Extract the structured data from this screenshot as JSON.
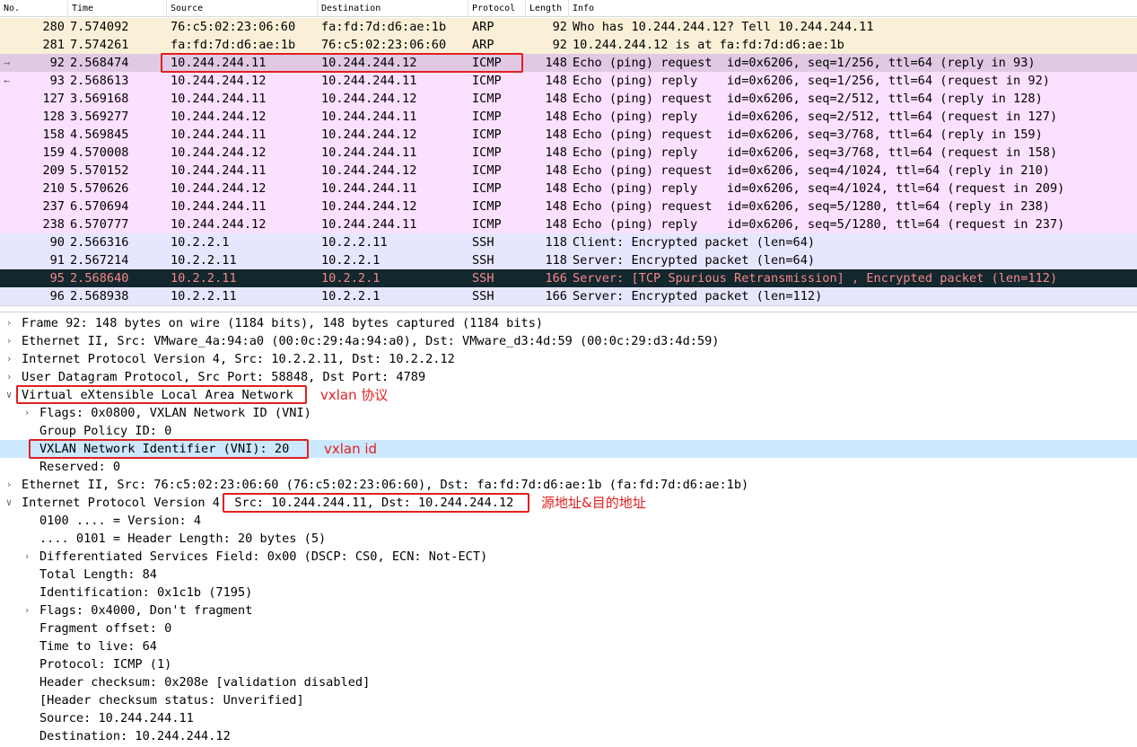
{
  "columns": {
    "no": "No.",
    "time": "Time",
    "source": "Source",
    "destination": "Destination",
    "protocol": "Protocol",
    "length": "Length",
    "info": "Info"
  },
  "colors": {
    "arp_bg": "#faf0d7",
    "icmp_bg": "#fce0ff",
    "selected_bg": "#e1c9e4",
    "ssh_bg": "#e7e6ff",
    "dark_bg": "#12272e",
    "dark_fg": "#f78787",
    "highlight_bg": "#cce8ff",
    "annotation": "#e02020"
  },
  "packets": [
    {
      "no": "280",
      "time": "7.574092",
      "src": "76:c5:02:23:06:60",
      "dst": "fa:fd:7d:d6:ae:1b",
      "proto": "ARP",
      "len": "92",
      "info": "Who has 10.244.244.12? Tell 10.244.244.11",
      "style": "arp"
    },
    {
      "no": "281",
      "time": "7.574261",
      "src": "fa:fd:7d:d6:ae:1b",
      "dst": "76:c5:02:23:06:60",
      "proto": "ARP",
      "len": "92",
      "info": "10.244.244.12 is at fa:fd:7d:d6:ae:1b",
      "style": "arp"
    },
    {
      "no": "92",
      "time": "2.568474",
      "src": "10.244.244.11",
      "dst": "10.244.244.12",
      "proto": "ICMP",
      "len": "148",
      "info": "Echo (ping) request  id=0x6206, seq=1/256, ttl=64 (reply in 93)",
      "style": "selected",
      "marker": "→"
    },
    {
      "no": "93",
      "time": "2.568613",
      "src": "10.244.244.12",
      "dst": "10.244.244.11",
      "proto": "ICMP",
      "len": "148",
      "info": "Echo (ping) reply    id=0x6206, seq=1/256, ttl=64 (request in 92)",
      "style": "icmp",
      "marker": "←"
    },
    {
      "no": "127",
      "time": "3.569168",
      "src": "10.244.244.11",
      "dst": "10.244.244.12",
      "proto": "ICMP",
      "len": "148",
      "info": "Echo (ping) request  id=0x6206, seq=2/512, ttl=64 (reply in 128)",
      "style": "icmp"
    },
    {
      "no": "128",
      "time": "3.569277",
      "src": "10.244.244.12",
      "dst": "10.244.244.11",
      "proto": "ICMP",
      "len": "148",
      "info": "Echo (ping) reply    id=0x6206, seq=2/512, ttl=64 (request in 127)",
      "style": "icmp"
    },
    {
      "no": "158",
      "time": "4.569845",
      "src": "10.244.244.11",
      "dst": "10.244.244.12",
      "proto": "ICMP",
      "len": "148",
      "info": "Echo (ping) request  id=0x6206, seq=3/768, ttl=64 (reply in 159)",
      "style": "icmp"
    },
    {
      "no": "159",
      "time": "4.570008",
      "src": "10.244.244.12",
      "dst": "10.244.244.11",
      "proto": "ICMP",
      "len": "148",
      "info": "Echo (ping) reply    id=0x6206, seq=3/768, ttl=64 (request in 158)",
      "style": "icmp"
    },
    {
      "no": "209",
      "time": "5.570152",
      "src": "10.244.244.11",
      "dst": "10.244.244.12",
      "proto": "ICMP",
      "len": "148",
      "info": "Echo (ping) request  id=0x6206, seq=4/1024, ttl=64 (reply in 210)",
      "style": "icmp"
    },
    {
      "no": "210",
      "time": "5.570626",
      "src": "10.244.244.12",
      "dst": "10.244.244.11",
      "proto": "ICMP",
      "len": "148",
      "info": "Echo (ping) reply    id=0x6206, seq=4/1024, ttl=64 (request in 209)",
      "style": "icmp"
    },
    {
      "no": "237",
      "time": "6.570694",
      "src": "10.244.244.11",
      "dst": "10.244.244.12",
      "proto": "ICMP",
      "len": "148",
      "info": "Echo (ping) request  id=0x6206, seq=5/1280, ttl=64 (reply in 238)",
      "style": "icmp"
    },
    {
      "no": "238",
      "time": "6.570777",
      "src": "10.244.244.12",
      "dst": "10.244.244.11",
      "proto": "ICMP",
      "len": "148",
      "info": "Echo (ping) reply    id=0x6206, seq=5/1280, ttl=64 (request in 237)",
      "style": "icmp"
    },
    {
      "no": "90",
      "time": "2.566316",
      "src": "10.2.2.1",
      "dst": "10.2.2.11",
      "proto": "SSH",
      "len": "118",
      "info": "Client: Encrypted packet (len=64)",
      "style": "ssh"
    },
    {
      "no": "91",
      "time": "2.567214",
      "src": "10.2.2.11",
      "dst": "10.2.2.1",
      "proto": "SSH",
      "len": "118",
      "info": "Server: Encrypted packet (len=64)",
      "style": "ssh"
    },
    {
      "no": "95",
      "time": "2.568640",
      "src": "10.2.2.11",
      "dst": "10.2.2.1",
      "proto": "SSH",
      "len": "166",
      "info": "Server: [TCP Spurious Retransmission] , Encrypted packet (len=112)",
      "style": "dark"
    },
    {
      "no": "96",
      "time": "2.568938",
      "src": "10.2.2.11",
      "dst": "10.2.2.1",
      "proto": "SSH",
      "len": "166",
      "info": "Server: Encrypted packet (len=112)",
      "style": "ssh"
    }
  ],
  "details": [
    {
      "indent": 0,
      "exp": "collapsed",
      "text": "Frame 92: 148 bytes on wire (1184 bits), 148 bytes captured (1184 bits)"
    },
    {
      "indent": 0,
      "exp": "collapsed",
      "text": "Ethernet II, Src: VMware_4a:94:a0 (00:0c:29:4a:94:a0), Dst: VMware_d3:4d:59 (00:0c:29:d3:4d:59)"
    },
    {
      "indent": 0,
      "exp": "collapsed",
      "text": "Internet Protocol Version 4, Src: 10.2.2.11, Dst: 10.2.2.12"
    },
    {
      "indent": 0,
      "exp": "collapsed",
      "text": "User Datagram Protocol, Src Port: 58848, Dst Port: 4789"
    },
    {
      "indent": 0,
      "exp": "expanded",
      "text": "Virtual eXtensible Local Area Network"
    },
    {
      "indent": 1,
      "exp": "collapsed",
      "text": "Flags: 0x0800, VXLAN Network ID (VNI)"
    },
    {
      "indent": 1,
      "exp": "",
      "text": "Group Policy ID: 0"
    },
    {
      "indent": 1,
      "exp": "",
      "text": "VXLAN Network Identifier (VNI): 20",
      "highlight": true
    },
    {
      "indent": 1,
      "exp": "",
      "text": "Reserved: 0"
    },
    {
      "indent": 0,
      "exp": "collapsed",
      "text": "Ethernet II, Src: 76:c5:02:23:06:60 (76:c5:02:23:06:60), Dst: fa:fd:7d:d6:ae:1b (fa:fd:7d:d6:ae:1b)"
    },
    {
      "indent": 0,
      "exp": "expanded",
      "text": "Internet Protocol Version 4, Src: 10.244.244.11, Dst: 10.244.244.12"
    },
    {
      "indent": 1,
      "exp": "",
      "text": "0100 .... = Version: 4"
    },
    {
      "indent": 1,
      "exp": "",
      "text": ".... 0101 = Header Length: 20 bytes (5)"
    },
    {
      "indent": 1,
      "exp": "collapsed",
      "text": "Differentiated Services Field: 0x00 (DSCP: CS0, ECN: Not-ECT)"
    },
    {
      "indent": 1,
      "exp": "",
      "text": "Total Length: 84"
    },
    {
      "indent": 1,
      "exp": "",
      "text": "Identification: 0x1c1b (7195)"
    },
    {
      "indent": 1,
      "exp": "collapsed",
      "text": "Flags: 0x4000, Don't fragment"
    },
    {
      "indent": 1,
      "exp": "",
      "text": "Fragment offset: 0"
    },
    {
      "indent": 1,
      "exp": "",
      "text": "Time to live: 64"
    },
    {
      "indent": 1,
      "exp": "",
      "text": "Protocol: ICMP (1)"
    },
    {
      "indent": 1,
      "exp": "",
      "text": "Header checksum: 0x208e [validation disabled]"
    },
    {
      "indent": 1,
      "exp": "",
      "text": "[Header checksum status: Unverified]"
    },
    {
      "indent": 1,
      "exp": "",
      "text": "Source: 10.244.244.11"
    },
    {
      "indent": 1,
      "exp": "",
      "text": "Destination: 10.244.244.12"
    }
  ],
  "annotations": {
    "vxlan_protocol": "vxlan 协议",
    "vxlan_id": "vxlan id",
    "src_dst": "源地址&目的地址"
  },
  "icons": {
    "expanded": "expanded-arrow-icon",
    "collapsed": "collapsed-arrow-icon",
    "sort": "sort-ascending-icon",
    "request": "request-arrow-icon",
    "reply": "reply-arrow-icon"
  }
}
